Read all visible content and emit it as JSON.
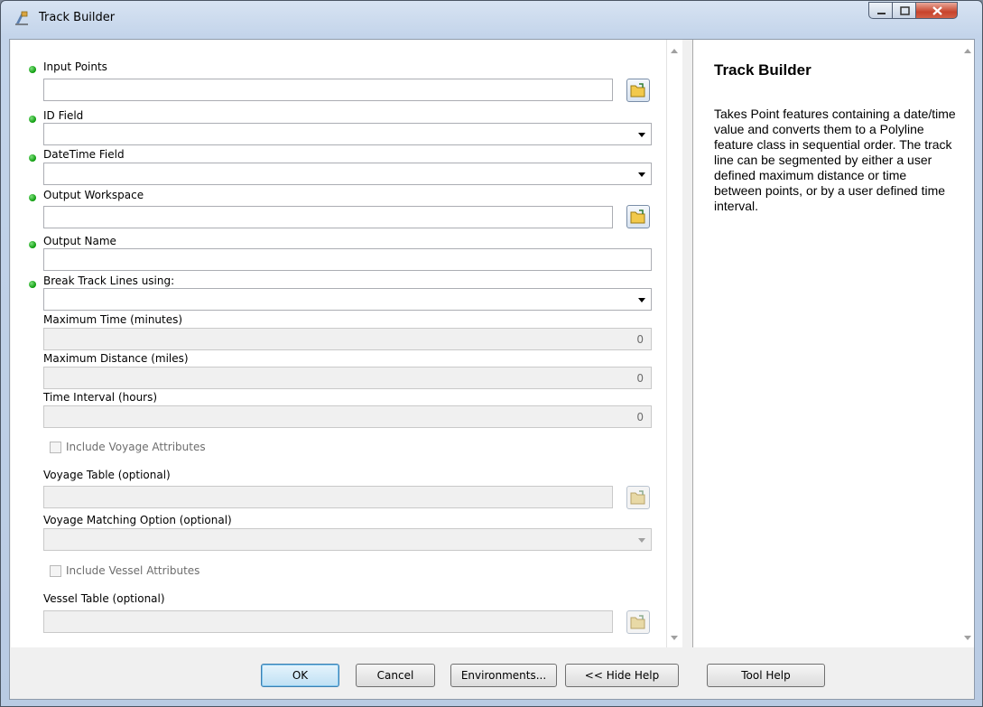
{
  "window": {
    "title": "Track Builder",
    "icon": "track-builder-tool-icon",
    "controls": [
      "minimize-icon",
      "maximize-icon",
      "close-icon"
    ]
  },
  "params": {
    "input_points": {
      "label": "Input Points",
      "value": ""
    },
    "id_field": {
      "label": "ID Field",
      "value": ""
    },
    "datetime_field": {
      "label": "DateTime Field",
      "value": ""
    },
    "output_workspace": {
      "label": "Output Workspace",
      "value": ""
    },
    "output_name": {
      "label": "Output Name",
      "value": ""
    },
    "break_track": {
      "label": "Break Track Lines using:",
      "value": ""
    },
    "max_time": {
      "label": "Maximum Time (minutes)",
      "value": "0"
    },
    "max_distance": {
      "label": "Maximum Distance (miles)",
      "value": "0"
    },
    "time_interval": {
      "label": "Time Interval (hours)",
      "value": "0"
    },
    "include_voyage": {
      "label": "Include Voyage Attributes",
      "checked": false
    },
    "voyage_table": {
      "label": "Voyage Table (optional)",
      "value": ""
    },
    "voyage_matching": {
      "label": "Voyage Matching Option (optional)",
      "value": ""
    },
    "include_vessel": {
      "label": "Include Vessel Attributes",
      "checked": false
    },
    "vessel_table": {
      "label": "Vessel Table (optional)",
      "value": ""
    }
  },
  "help": {
    "title": "Track Builder",
    "text": "Takes Point features containing a date/time value and converts them to a Polyline feature class in sequential order. The track line can be segmented by either a user defined maximum distance or time between points, or by a user defined time interval."
  },
  "buttons": {
    "ok": "OK",
    "cancel": "Cancel",
    "environments": "Environments...",
    "hide_help": "<< Hide Help",
    "tool_help": "Tool Help"
  },
  "colors": {
    "required_dot": "#0a9a0a",
    "title_bar": "#c3d4ea",
    "close_button": "#c7432b",
    "ok_highlight": "#3c7fb1"
  }
}
